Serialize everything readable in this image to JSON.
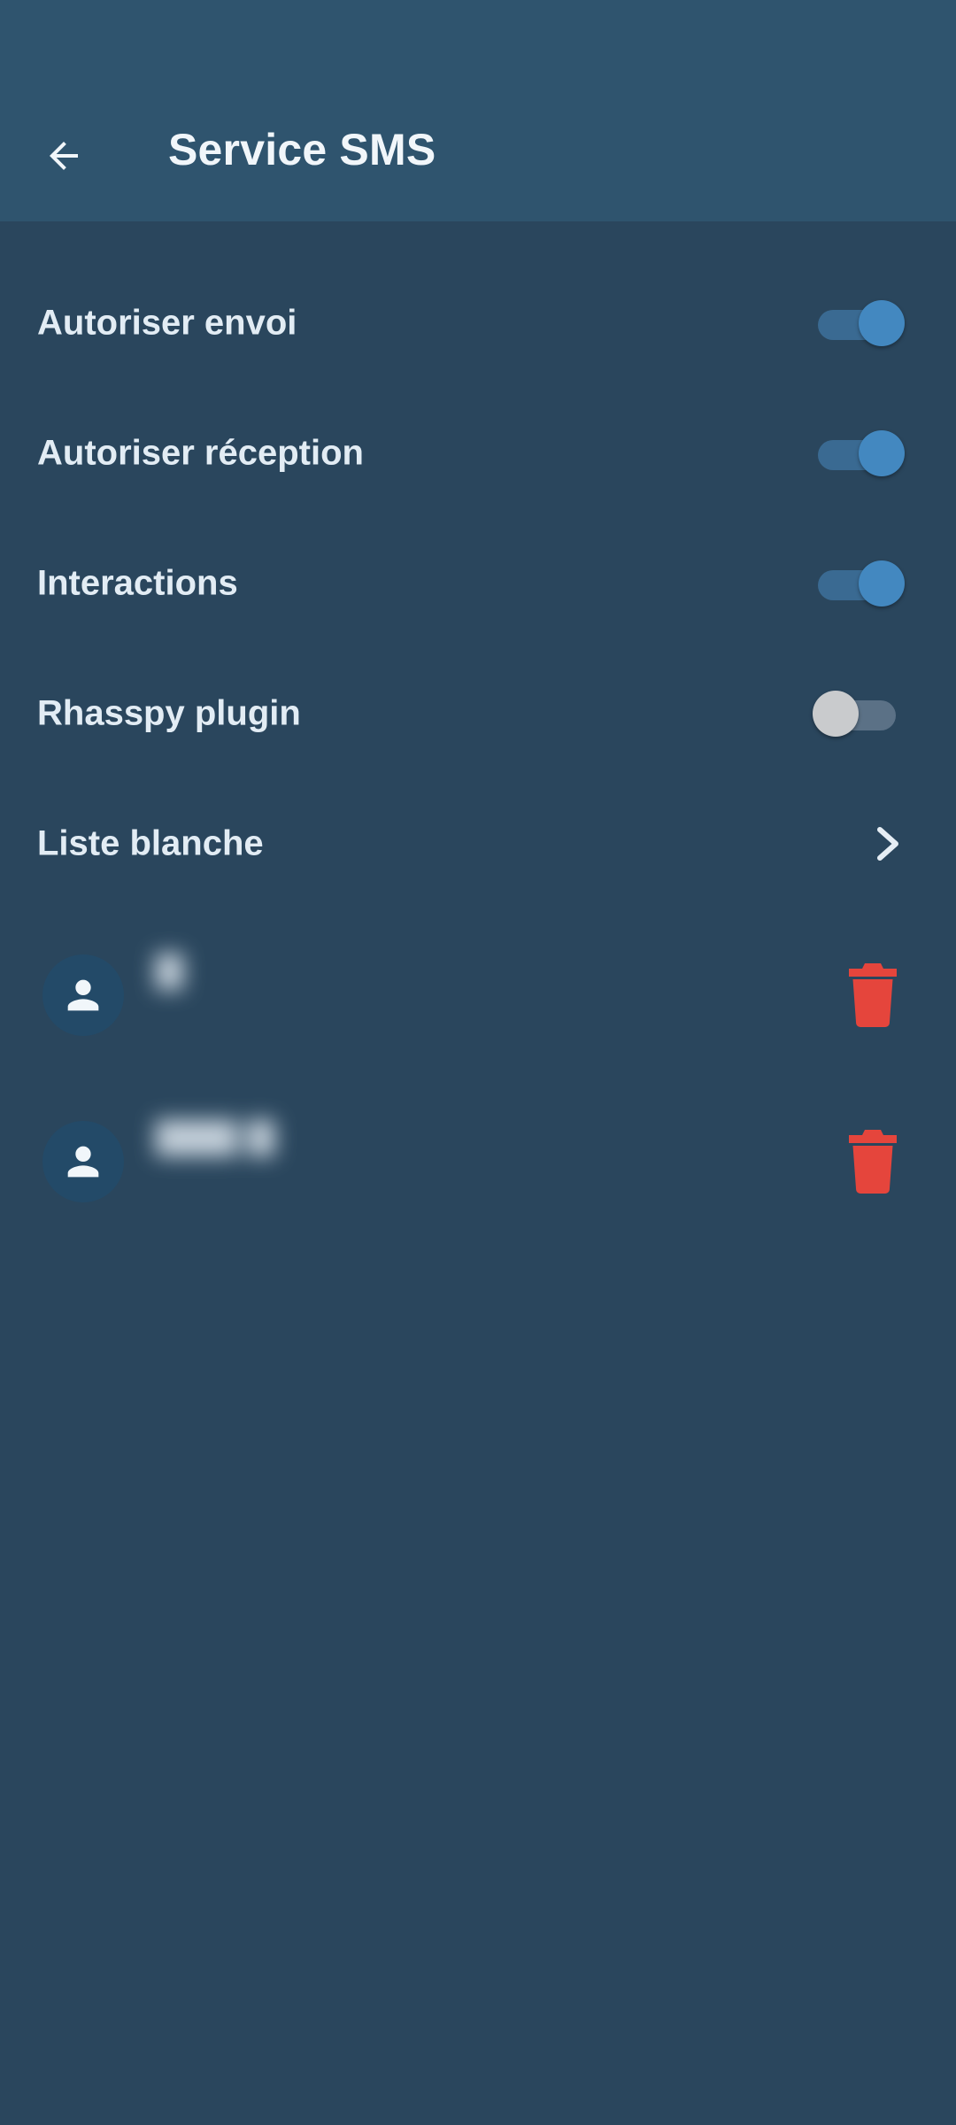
{
  "app_bar": {
    "title": "Service SMS",
    "back_icon": "arrow-left-icon"
  },
  "settings": [
    {
      "label": "Autoriser envoi",
      "enabled": true
    },
    {
      "label": "Autoriser réception",
      "enabled": true
    },
    {
      "label": "Interactions",
      "enabled": true
    },
    {
      "label": "Rhasspy plugin",
      "enabled": false
    }
  ],
  "whitelist": {
    "label": "Liste blanche",
    "icon": "chevron-right-icon"
  },
  "contacts": [
    {
      "name": "▇",
      "number": "",
      "icon": "person-icon",
      "delete_icon": "trash-icon"
    },
    {
      "name": "▇▇▇ ▇",
      "number": "",
      "icon": "person-icon",
      "delete_icon": "trash-icon"
    }
  ],
  "colors": {
    "app_bar": "#2f546e",
    "background": "#2a465d",
    "toggle_on": "#4388c0",
    "toggle_off": "#c9cbcd",
    "delete": "#e5453c"
  }
}
